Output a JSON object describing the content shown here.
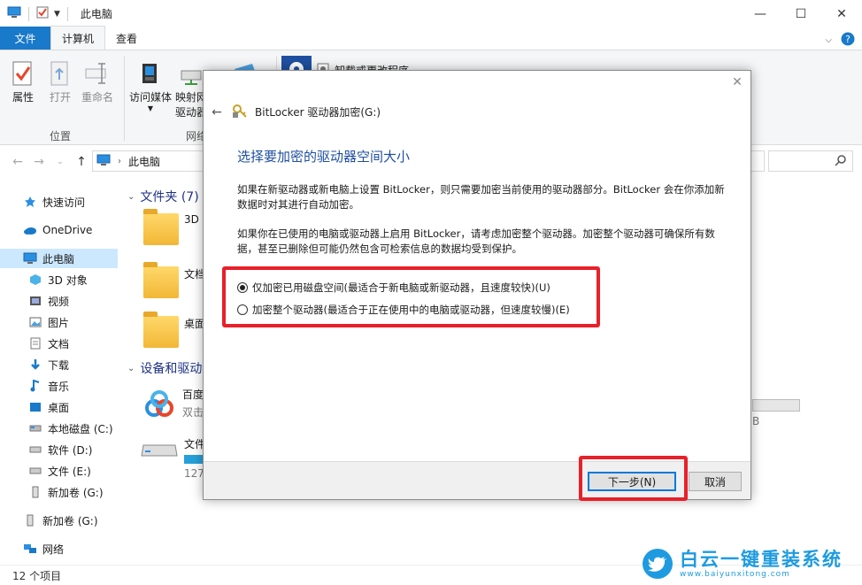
{
  "window": {
    "title": "此电脑",
    "minimize": "—",
    "maximize": "☐",
    "close": "✕"
  },
  "ribbon_tabs": [
    "文件",
    "计算机",
    "查看"
  ],
  "ribbon": {
    "properties": "属性",
    "open": "打开",
    "rename": "重命名",
    "access_media": "访问媒体",
    "map_drive_line1": "映射网",
    "map_drive_line2": "驱动器",
    "uninstall": "卸载或更改程序",
    "group_location": "位置",
    "group_network": "网络"
  },
  "address": {
    "path": "此电脑"
  },
  "nav": {
    "quick_access": "快速访问",
    "onedrive": "OneDrive",
    "this_pc": "此电脑",
    "objects_3d": "3D 对象",
    "videos": "视频",
    "pictures": "图片",
    "documents": "文档",
    "downloads": "下载",
    "music": "音乐",
    "desktop": "桌面",
    "local_disk": "本地磁盘 (C:)",
    "software": "软件 (D:)",
    "files": "文件 (E:)",
    "new_vol_1": "新加卷 (G:)",
    "new_vol_2": "新加卷 (G:)",
    "network": "网络"
  },
  "content": {
    "folders_header": "文件夹 (7)",
    "devices_header": "设备和驱动",
    "folder_3d": "3D",
    "folder_docs": "文档",
    "folder_desktop": "桌面",
    "baidu_line1": "百度",
    "baidu_line2": "双击",
    "drive_label": "文件",
    "drive_size": "127",
    "right_clip": "B"
  },
  "status": {
    "item_count": "12 个项目"
  },
  "dialog": {
    "header": "BitLocker 驱动器加密(G:)",
    "title": "选择要加密的驱动器空间大小",
    "para1": "如果在新驱动器或新电脑上设置 BitLocker，则只需要加密当前使用的驱动器部分。BitLocker 会在你添加新数据时对其进行自动加密。",
    "para2": "如果你在已使用的电脑或驱动器上启用 BitLocker，请考虑加密整个驱动器。加密整个驱动器可确保所有数据，甚至已删除但可能仍然包含可检索信息的数据均受到保护。",
    "option_used": "仅加密已用磁盘空间(最适合于新电脑或新驱动器，且速度较快)(U)",
    "option_whole": "加密整个驱动器(最适合于正在使用中的电脑或驱动器，但速度较慢)(E)",
    "option_selected": "used",
    "next_button": "下一步(N)",
    "cancel_button": "取消"
  },
  "watermark": {
    "name": "白云一键重装系统",
    "url": "www.baiyunxitong.com"
  },
  "colors": {
    "accent": "#1979ca",
    "highlight": "#e8202a",
    "dialog_title": "#1f4fa0",
    "watermark": "#1e9be0"
  }
}
